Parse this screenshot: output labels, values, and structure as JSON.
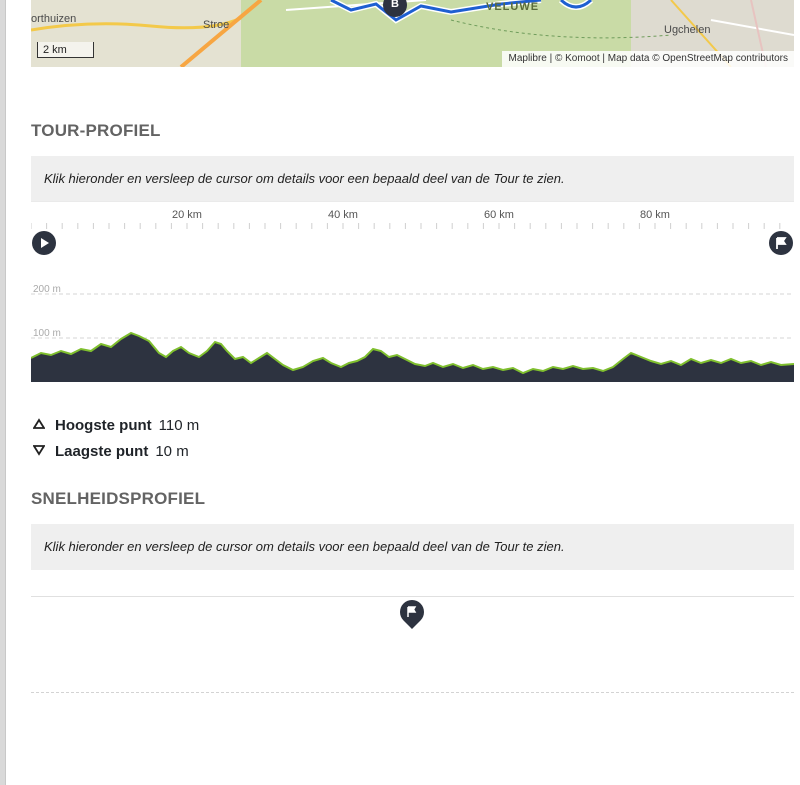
{
  "map": {
    "labels": {
      "town_left": "orthuizen",
      "stroe": "Stroe",
      "veluwe": "VELUWE",
      "ugchelen": "Ugchelen",
      "waypoint_b": "B"
    },
    "scale": "2 km",
    "attribution": "Maplibre | © Komoot | Map data © OpenStreetMap contributors"
  },
  "tour_profile": {
    "title": "TOUR-PROFIEL",
    "hint": "Klik hieronder en versleep de cursor om details voor een bepaald deel van de Tour te zien.",
    "distance_ticks": [
      "20 km",
      "40 km",
      "60 km",
      "80 km"
    ],
    "elevation_ticks": [
      "200 m",
      "100 m"
    ],
    "start_icon": "play-icon",
    "finish_icon": "flag-icon"
  },
  "stats": {
    "highest_label": "Hoogste punt",
    "highest_value": "110 m",
    "lowest_label": "Laagste punt",
    "lowest_value": "10 m",
    "highest_icon": "triangle-up-icon",
    "lowest_icon": "triangle-down-icon"
  },
  "speed_profile": {
    "title": "SNELHEIDSPROFIEL",
    "hint": "Klik hieronder en versleep de cursor om details voor een bepaald deel van de Tour te zien.",
    "marker_icon": "flag-icon"
  },
  "colors": {
    "profile_fill": "#2d3340",
    "profile_line": "#7fbf2e",
    "route": "#1e5fd1",
    "map_green": "#c8d9a6"
  }
}
